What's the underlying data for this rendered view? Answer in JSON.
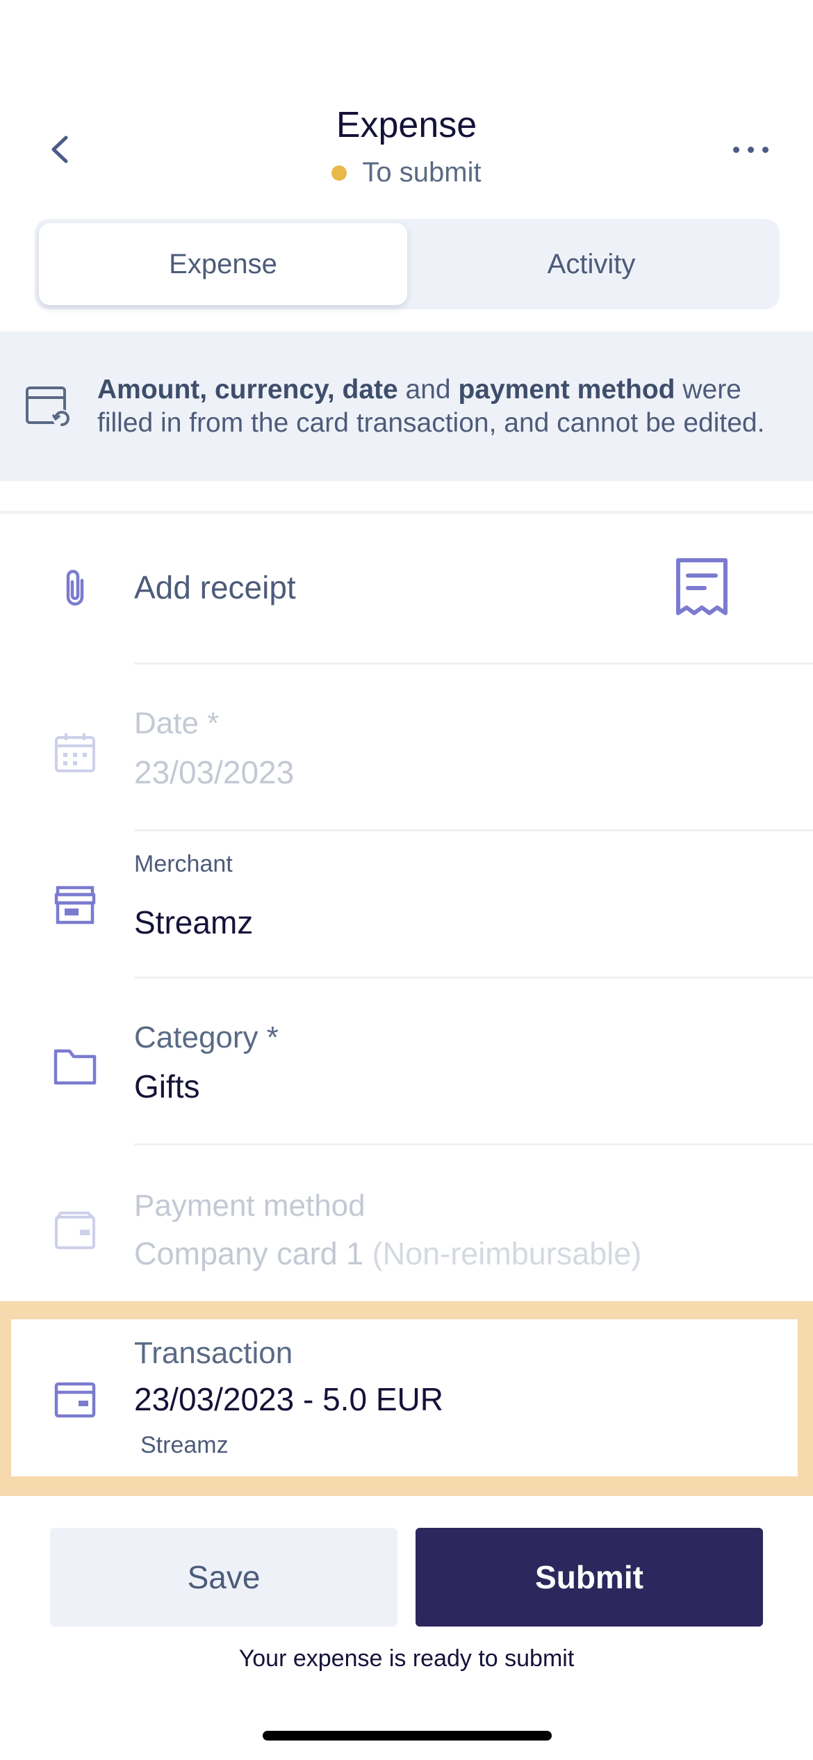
{
  "header": {
    "title": "Expense",
    "status": "To submit",
    "status_color": "#e8b84a"
  },
  "tabs": [
    {
      "label": "Expense",
      "active": true
    },
    {
      "label": "Activity",
      "active": false
    }
  ],
  "banner": {
    "bold1": "Amount, currency, date",
    "text1": " and ",
    "bold2": "payment method",
    "text2": " were filled in from the card transaction, and cannot be edited."
  },
  "receipt": {
    "label": "Add receipt"
  },
  "date": {
    "label": "Date *",
    "value": "23/03/2023"
  },
  "merchant": {
    "label": "Merchant",
    "value": "Streamz"
  },
  "category": {
    "label": "Category *",
    "value": "Gifts"
  },
  "payment": {
    "label": "Payment method",
    "value": "Company card 1",
    "note": " (Non-reimbursable)"
  },
  "transaction": {
    "label": "Transaction",
    "value": "23/03/2023 - 5.0 EUR",
    "merchant": "Streamz"
  },
  "footer": {
    "save_label": "Save",
    "submit_label": "Submit",
    "ready_text": "Your expense is ready to submit"
  },
  "colors": {
    "accent": "#7b7bd0",
    "primary": "#2c275c",
    "highlight": "#f6d9ad"
  }
}
